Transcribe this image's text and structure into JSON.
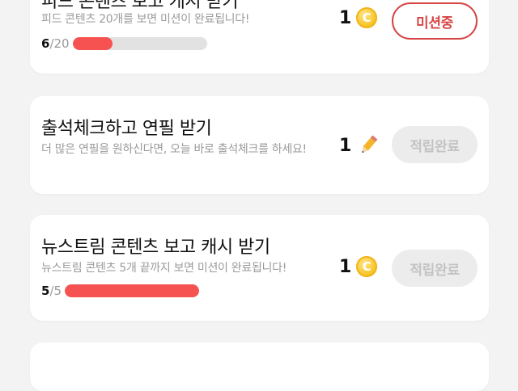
{
  "missions": [
    {
      "title": "피드 콘텐츠 보고 캐시 받기",
      "desc": "피드 콘텐츠 20개를 보면 미션이 완료됩니다!",
      "progress_current": "6",
      "progress_total": "/20",
      "progress_fraction": 0.3,
      "reward": "1",
      "reward_icon": "coin-icon",
      "coin_symbol": "C",
      "button": "미션중"
    },
    {
      "title": "출석체크하고 연필 받기",
      "desc": "더 많은 연필을 원하신다면, 오늘 바로 출석체크를 하세요!",
      "reward": "1",
      "reward_icon": "pencil-icon",
      "button": "적립완료"
    },
    {
      "title": "뉴스트림 콘텐츠 보고 캐시 받기",
      "desc": "뉴스트림 콘텐츠 5개 끝까지 보면 미션이 완료됩니다!",
      "progress_current": "5",
      "progress_total": "/5",
      "progress_fraction": 1.0,
      "reward": "1",
      "reward_icon": "coin-icon",
      "coin_symbol": "C",
      "button": "적립완료"
    }
  ],
  "colors": {
    "accent": "#d64545",
    "progress": "#f75252",
    "coin": "#f7c62a",
    "done_bg": "#ececec"
  }
}
